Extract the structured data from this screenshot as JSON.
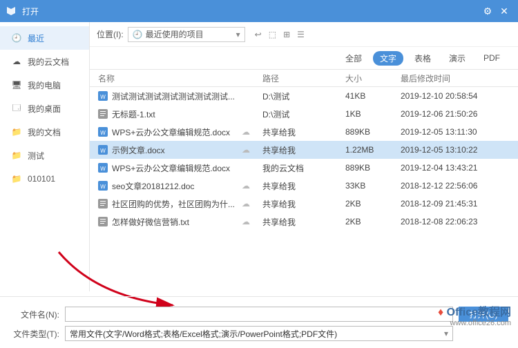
{
  "title": "打开",
  "sidebar": [
    {
      "label": "最近",
      "icon": "clock",
      "active": true
    },
    {
      "label": "我的云文档",
      "icon": "cloud",
      "active": false
    },
    {
      "label": "我的电脑",
      "icon": "pc",
      "active": false
    },
    {
      "label": "我的桌面",
      "icon": "desktop",
      "active": false
    },
    {
      "label": "我的文档",
      "icon": "folder",
      "active": false
    },
    {
      "label": "测试",
      "icon": "folder",
      "active": false
    },
    {
      "label": "010101",
      "icon": "folder",
      "active": false
    }
  ],
  "location_label": "位置(I):",
  "location_value": "最近使用的项目",
  "filters": [
    {
      "label": "全部",
      "active": false
    },
    {
      "label": "文字",
      "active": true
    },
    {
      "label": "表格",
      "active": false
    },
    {
      "label": "演示",
      "active": false
    },
    {
      "label": "PDF",
      "active": false
    }
  ],
  "columns": {
    "name": "名称",
    "path": "路径",
    "size": "大小",
    "date": "最后修改时间"
  },
  "files": [
    {
      "name": "测试测试测试测试测试测试测试...",
      "cloud": false,
      "path": "D:\\测试",
      "size": "41KB",
      "date": "2019-12-10 20:58:54",
      "icon": "doc"
    },
    {
      "name": "无标题-1.txt",
      "cloud": false,
      "path": "D:\\测试",
      "size": "1KB",
      "date": "2019-12-06 21:50:26",
      "icon": "txt"
    },
    {
      "name": "WPS+云办公文章编辑规范.docx",
      "cloud": true,
      "path": "共享给我",
      "size": "889KB",
      "date": "2019-12-05 13:11:30",
      "icon": "doc"
    },
    {
      "name": "示例文章.docx",
      "cloud": true,
      "path": "共享给我",
      "size": "1.22MB",
      "date": "2019-12-05 13:10:22",
      "icon": "doc",
      "selected": true
    },
    {
      "name": "WPS+云办公文章编辑规范.docx",
      "cloud": false,
      "path": "我的云文档",
      "size": "889KB",
      "date": "2019-12-04 13:43:21",
      "icon": "doc"
    },
    {
      "name": "seo文章20181212.doc",
      "cloud": true,
      "path": "共享给我",
      "size": "33KB",
      "date": "2018-12-12 22:56:06",
      "icon": "doc"
    },
    {
      "name": "社区团购的优势，社区团购为什...",
      "cloud": true,
      "path": "共享给我",
      "size": "2KB",
      "date": "2018-12-09 21:45:31",
      "icon": "txt"
    },
    {
      "name": "怎样做好微信营销.txt",
      "cloud": true,
      "path": "共享给我",
      "size": "2KB",
      "date": "2018-12-08 22:06:23",
      "icon": "txt"
    }
  ],
  "filename_label": "文件名(N):",
  "filename_value": "",
  "open_button": "打开(O)",
  "filetype_label": "文件类型(T):",
  "filetype_value": "常用文件(文字/Word格式;表格/Excel格式;演示/PowerPoint格式;PDF文件)",
  "watermark": {
    "brand": "Office",
    "suffix": "教程网",
    "url": "www.office26.com"
  }
}
